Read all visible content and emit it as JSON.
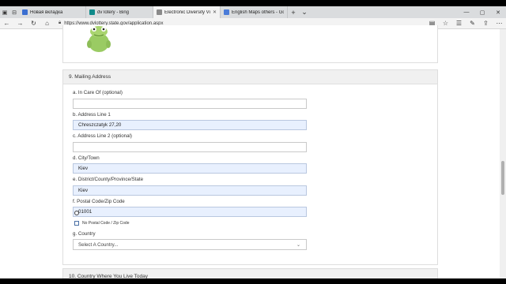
{
  "browser": {
    "tabs": [
      {
        "title": "Новая вкладка",
        "active": false,
        "favicon_color": "#3b6fd1"
      },
      {
        "title": "dv lotery - Bing",
        "active": false,
        "favicon_color": "#0f8a8a"
      },
      {
        "title": "Electronic Diversity Visa",
        "active": true,
        "favicon_color": "#8a8a8a"
      },
      {
        "title": "English Maps others - Goog",
        "active": false,
        "favicon_color": "#4a7bd8"
      }
    ],
    "url": "https://www.dvlottery.state.gov/application.aspx"
  },
  "form": {
    "section_title": "9. Mailing Address",
    "in_care_of": {
      "label": "a. In Care Of (optional)",
      "value": ""
    },
    "address_line1": {
      "label": "b. Address Line 1",
      "value": "Chreszczatyk 27,20"
    },
    "address_line2": {
      "label": "c. Address Line 2 (optional)",
      "value": ""
    },
    "city": {
      "label": "d. City/Town",
      "value": "Kiev"
    },
    "district": {
      "label": "e. District/County/Province/State",
      "value": "Kiev"
    },
    "postal": {
      "label": "f. Postal Code/Zip Code",
      "value": "01001"
    },
    "no_postal_label": "No Postal Code / Zip Code",
    "country": {
      "label": "g. Country",
      "selected": "Select A Country..."
    },
    "next_section_title": "10. Country Where You Live Today"
  },
  "colors": {
    "filled_field": "#e8f0fe",
    "section_header": "#f0f0f0"
  }
}
